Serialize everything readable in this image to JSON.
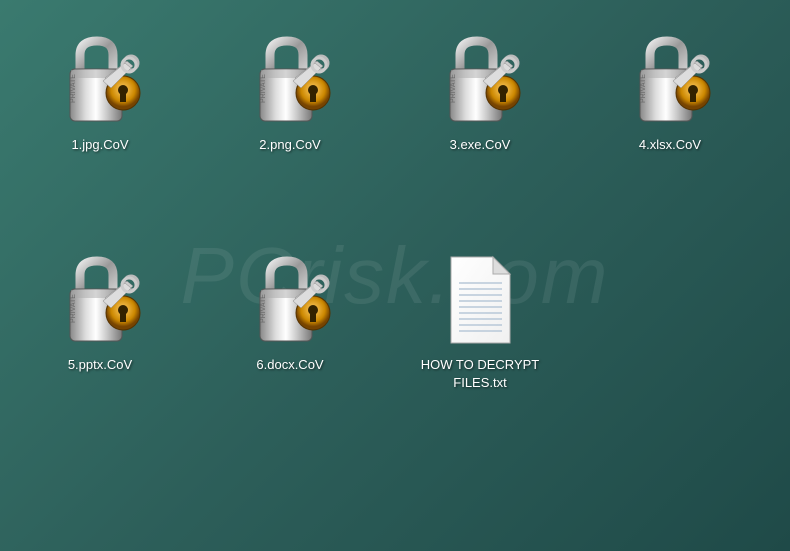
{
  "watermark": "PCrisk.com",
  "icons": [
    {
      "label": "1.jpg.CoV",
      "type": "padlock"
    },
    {
      "label": "2.png.CoV",
      "type": "padlock"
    },
    {
      "label": "3.exe.CoV",
      "type": "padlock"
    },
    {
      "label": "4.xlsx.CoV",
      "type": "padlock"
    },
    {
      "label": "5.pptx.CoV",
      "type": "padlock"
    },
    {
      "label": "6.docx.CoV",
      "type": "padlock"
    },
    {
      "label": "HOW TO DECRYPT FILES.txt",
      "type": "textfile"
    }
  ]
}
